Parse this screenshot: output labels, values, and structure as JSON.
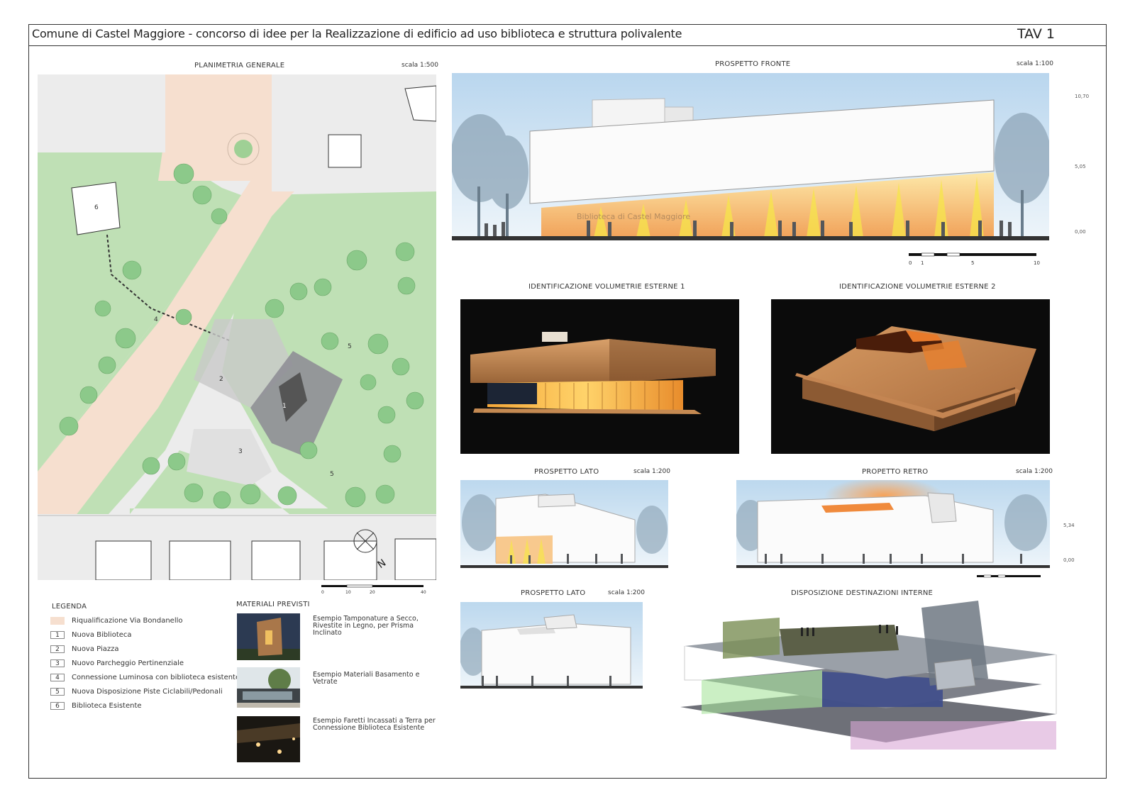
{
  "header": {
    "title": "Comune di Castel Maggiore - concorso di idee per la Realizzazione di edificio ad uso biblioteca e struttura polivalente",
    "sheet_id": "TAV 1"
  },
  "planimetria": {
    "title": "PLANIMETRIA GENERALE",
    "scale": "scala 1:500",
    "markers": [
      "6",
      "4",
      "2",
      "1",
      "3",
      "5",
      "5"
    ],
    "north": "N",
    "scalebar": [
      "0",
      "10",
      "20",
      "40"
    ]
  },
  "prospetto_fronte": {
    "title": "PROSPETTO FRONTE",
    "scale": "scala 1:100",
    "sign": "Biblioteca di Castel Maggiore",
    "levels": [
      "10,70",
      "5,05",
      "0,00"
    ],
    "scalebar": [
      "0",
      "1",
      "5",
      "10"
    ]
  },
  "volumetrie_1": {
    "title": "IDENTIFICAZIONE VOLUMETRIE ESTERNE 1"
  },
  "volumetrie_2": {
    "title": "IDENTIFICAZIONE VOLUMETRIE ESTERNE 2"
  },
  "prospetto_lato_1": {
    "title": "PROSPETTO LATO",
    "scale": "scala 1:200"
  },
  "prospetto_retro": {
    "title": "PROPETTO RETRO",
    "scale": "scala 1:200",
    "levels": [
      "5,34",
      "0,00"
    ]
  },
  "prospetto_lato_2": {
    "title": "PROSPETTO LATO",
    "scale": "scala 1:200"
  },
  "disposizione": {
    "title": "DISPOSIZIONE DESTINAZIONI INTERNE"
  },
  "legenda": {
    "title": "LEGENDA",
    "items": [
      {
        "key": "",
        "text": "Riqualificazione Via Bondanello"
      },
      {
        "key": "1",
        "text": "Nuova Biblioteca"
      },
      {
        "key": "2",
        "text": "Nuova Piazza"
      },
      {
        "key": "3",
        "text": "Nuovo Parcheggio Pertinenziale"
      },
      {
        "key": "4",
        "text": "Connessione Luminosa con biblioteca esistente"
      },
      {
        "key": "5",
        "text": "Nuova Disposizione Piste Ciclabili/Pedonali"
      },
      {
        "key": "6",
        "text": "Biblioteca Esistente"
      }
    ]
  },
  "materiali": {
    "title": "MATERIALI PREVISTI",
    "items": [
      {
        "text": "Esempio Tamponature a Secco, Rivestite in Legno, per Prisma Inclinato"
      },
      {
        "text": "Esempio Materiali Basamento e Vetrate"
      },
      {
        "text": "Esempio Faretti Incassati a Terra per Connessione Biblioteca Esistente"
      }
    ]
  },
  "colors": {
    "park_green": "#bfe0b5",
    "tree_green": "#8cc98a",
    "road_pink": "#f6dfcf",
    "sky_blue": "#cfe3f2",
    "glow_orange": "#f3a44a",
    "night_bg": "#0c0c0c",
    "wood": "#c98f5c"
  }
}
